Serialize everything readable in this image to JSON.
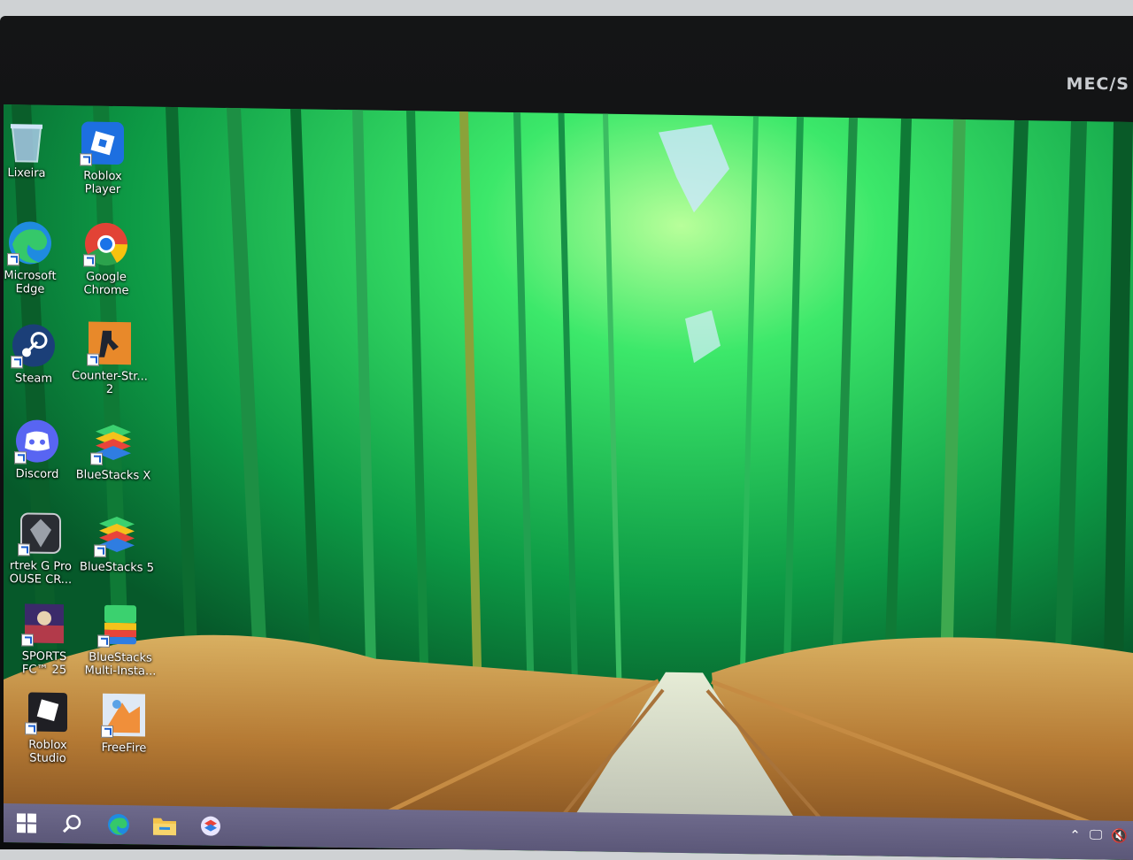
{
  "monitor": {
    "brand": "MEC/S"
  },
  "desktop": {
    "icons": [
      {
        "label": "Lixeira",
        "icon": "recycle-bin-icon"
      },
      {
        "label": "Roblox\nPlayer",
        "icon": "roblox-player-icon"
      },
      {
        "label": "Microsoft\nEdge",
        "icon": "edge-icon"
      },
      {
        "label": "Google\nChrome",
        "icon": "chrome-icon"
      },
      {
        "label": "Steam",
        "icon": "steam-icon"
      },
      {
        "label": "Counter-Str...\n2",
        "icon": "counter-strike-icon"
      },
      {
        "label": "Discord",
        "icon": "discord-icon"
      },
      {
        "label": "BlueStacks X",
        "icon": "bluestacks-x-icon"
      },
      {
        "label": "rtrek G Pro\nOUSE CR...",
        "icon": "gaming-mouse-icon"
      },
      {
        "label": "BlueStacks 5",
        "icon": "bluestacks-5-icon"
      },
      {
        "label": "SPORTS\nFC™ 25",
        "icon": "sports-fc-icon"
      },
      {
        "label": "BlueStacks\nMulti-Insta...",
        "icon": "bluestacks-multi-icon"
      },
      {
        "label": "Roblox\nStudio",
        "icon": "roblox-studio-icon"
      },
      {
        "label": "FreeFire",
        "icon": "freefire-icon"
      }
    ]
  },
  "taskbar": {
    "items": [
      "start",
      "search",
      "edge",
      "file-explorer",
      "bluestacks"
    ],
    "tray": [
      "chevron-up-icon",
      "network-icon",
      "volume-icon"
    ]
  }
}
